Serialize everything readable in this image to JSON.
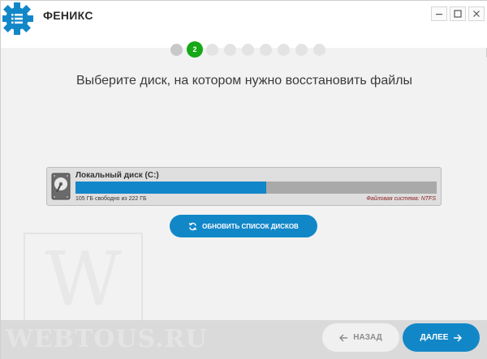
{
  "app": {
    "name": "ФЕНИКС",
    "logo_icon": "gear-list-icon",
    "accent": "#1287c8"
  },
  "window_controls": {
    "minimize_icon": "minimize-icon",
    "maximize_icon": "maximize-icon",
    "close_icon": "close-icon"
  },
  "steps": {
    "current_label": "2",
    "current": 2,
    "total": 9
  },
  "title": "Выберите диск, на котором нужно восстановить файлы",
  "disk": {
    "name": "Локальный диск (C:)",
    "free_text": "105 ГБ свободно из 222 ГБ",
    "fs_text": "Файловая система: NTFS",
    "used_fraction": 0.527,
    "icon": "hard-drive-icon"
  },
  "refresh_button": {
    "label": "ОБНОВИТЬ СПИСОК ДИСКОВ",
    "icon": "refresh-icon"
  },
  "watermark": {
    "letter": "W",
    "text": "WEBTOUS.RU"
  },
  "nav": {
    "back_label": "НАЗАД",
    "back_icon": "arrow-left-icon",
    "next_label": "ДАЛЕЕ",
    "next_icon": "arrow-right-icon"
  }
}
